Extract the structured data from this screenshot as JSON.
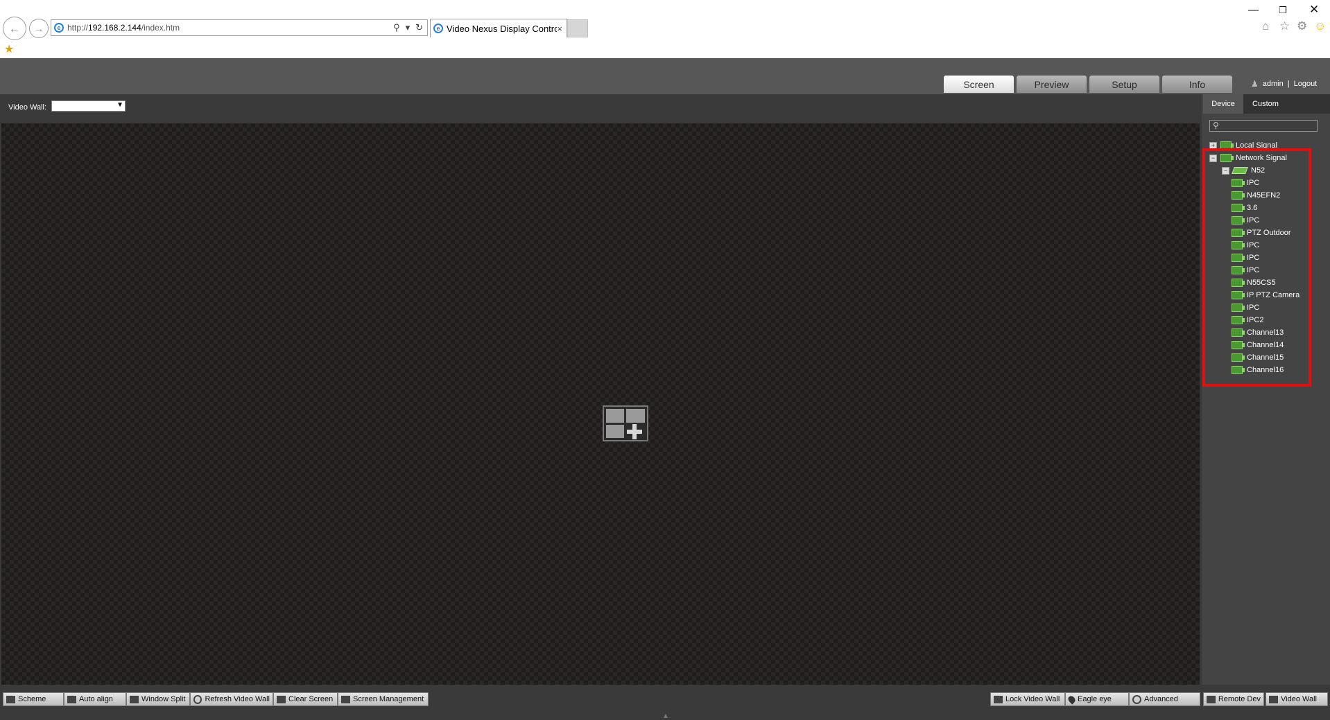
{
  "browser": {
    "url_prefix": "http://",
    "url_host": "192.168.2.144",
    "url_path": "/index.htm",
    "tab_title": "Video Nexus Display Contro...",
    "tab_close": "×",
    "icons": {
      "back": "back-arrow-icon",
      "forward": "forward-arrow-icon",
      "search": "search-icon",
      "refresh": "refresh-icon",
      "home": "home-icon",
      "favorites": "star-icon",
      "tools": "gear-icon",
      "feedback": "smiley-icon"
    }
  },
  "header": {
    "tabs": [
      {
        "label": "Screen",
        "active": true
      },
      {
        "label": "Preview",
        "active": false
      },
      {
        "label": "Setup",
        "active": false
      },
      {
        "label": "Info",
        "active": false
      }
    ],
    "user": "admin",
    "separator": "|",
    "logout": "Logout"
  },
  "wall": {
    "label": "Video Wall:",
    "selected": ""
  },
  "panel": {
    "subtabs": [
      "Device",
      "Custom"
    ],
    "search_placeholder": "",
    "tree": {
      "local": "Local Signal",
      "network": "Network Signal",
      "device": "N52",
      "channels": [
        "IPC",
        "N45EFN2",
        "3.6",
        "IPC",
        "PTZ Outdoor",
        "IPC",
        "IPC",
        "IPC",
        "N55CS5",
        "IP PTZ Camera",
        "IPC",
        "IPC2",
        "Channel13",
        "Channel14",
        "Channel15",
        "Channel16"
      ]
    },
    "highlight_color": "#e01010"
  },
  "bottom_toolbar": {
    "left": [
      "Scheme",
      "Auto align",
      "Window Split",
      "Refresh Video Wall",
      "Clear Screen",
      "Screen Management"
    ],
    "right": [
      "Lock Video Wall",
      "Eagle eye",
      "Advanced",
      "Remote Dev",
      "Video Wall"
    ]
  },
  "colors": {
    "header_bg": "#575757",
    "canvas_bg": "#1f1c1c",
    "tree_icon_green": "#4a9a34"
  }
}
